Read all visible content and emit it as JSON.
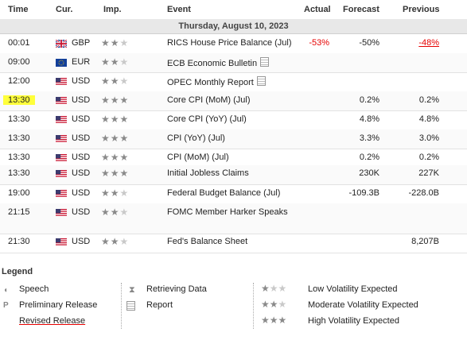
{
  "columns": {
    "time": "Time",
    "cur": "Cur.",
    "imp": "Imp.",
    "event": "Event",
    "actual": "Actual",
    "forecast": "Forecast",
    "previous": "Previous"
  },
  "date": "Thursday, August 10, 2023",
  "rows": [
    {
      "time": "00:01",
      "cur": "GBP",
      "flag": "gb",
      "stars": 2,
      "event": "RICS House Price Balance (Jul)",
      "actual": "-53%",
      "forecast": "-50%",
      "previous": "-48%"
    },
    {
      "time": "09:00",
      "cur": "EUR",
      "flag": "eu",
      "stars": 2,
      "event": "ECB Economic Bulletin",
      "actual": "",
      "forecast": "",
      "previous": ""
    },
    {
      "time": "12:00",
      "cur": "USD",
      "flag": "us",
      "stars": 2,
      "event": "OPEC Monthly Report",
      "actual": "",
      "forecast": "",
      "previous": ""
    },
    {
      "time": "13:30",
      "cur": "USD",
      "flag": "us",
      "stars": 3,
      "event": "Core CPI (MoM) (Jul)",
      "actual": "",
      "forecast": "0.2%",
      "previous": "0.2%"
    },
    {
      "time": "13:30",
      "cur": "USD",
      "flag": "us",
      "stars": 3,
      "event": "Core CPI (YoY) (Jul)",
      "actual": "",
      "forecast": "4.8%",
      "previous": "4.8%"
    },
    {
      "time": "13:30",
      "cur": "USD",
      "flag": "us",
      "stars": 3,
      "event": "CPI (YoY) (Jul)",
      "actual": "",
      "forecast": "3.3%",
      "previous": "3.0%"
    },
    {
      "time": "13:30",
      "cur": "USD",
      "flag": "us",
      "stars": 3,
      "event": "CPI (MoM) (Jul)",
      "actual": "",
      "forecast": "0.2%",
      "previous": "0.2%"
    },
    {
      "time": "13:30",
      "cur": "USD",
      "flag": "us",
      "stars": 3,
      "event": "Initial Jobless Claims",
      "actual": "",
      "forecast": "230K",
      "previous": "227K"
    },
    {
      "time": "19:00",
      "cur": "USD",
      "flag": "us",
      "stars": 2,
      "event": "Federal Budget Balance (Jul)",
      "actual": "",
      "forecast": "-109.3B",
      "previous": "-228.0B"
    },
    {
      "time": "21:15",
      "cur": "USD",
      "flag": "us",
      "stars": 2,
      "event": "FOMC Member Harker Speaks",
      "actual": "",
      "forecast": "",
      "previous": ""
    },
    {
      "time": "21:30",
      "cur": "USD",
      "flag": "us",
      "stars": 2,
      "event": "Fed's Balance Sheet",
      "actual": "",
      "forecast": "",
      "previous": "8,207B"
    }
  ],
  "legend": {
    "title": "Legend",
    "speech": "Speech",
    "preliminary": "Preliminary Release",
    "revised": "Revised Release",
    "retrieving": "Retrieving Data",
    "report": "Report",
    "low": "Low Volatility Expected",
    "moderate": "Moderate Volatility Expected",
    "high": "High Volatility Expected"
  },
  "colors": {
    "negative": "#e60000",
    "highlight": "#ffff3a",
    "star_on": "#8a8a8a",
    "star_off": "#c9c9c9"
  }
}
